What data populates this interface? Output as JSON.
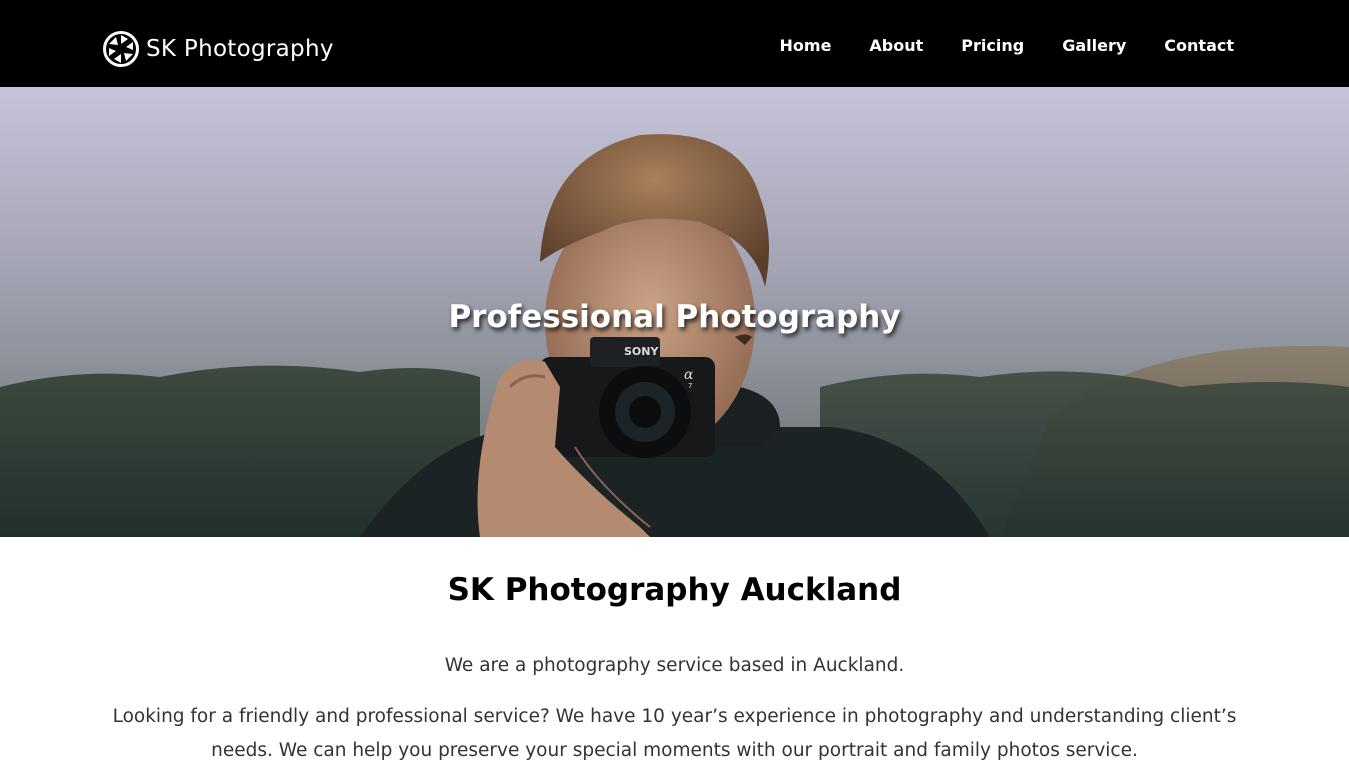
{
  "header": {
    "logo_text": "SK Photography",
    "logo_icon": "camera-aperture-icon"
  },
  "nav": {
    "items": [
      {
        "label": "Home"
      },
      {
        "label": "About"
      },
      {
        "label": "Pricing"
      },
      {
        "label": "Gallery"
      },
      {
        "label": "Contact"
      }
    ]
  },
  "hero": {
    "title": "Professional Photography",
    "camera_brand": "SONY",
    "camera_model": "α",
    "camera_model_sub": "7"
  },
  "content": {
    "heading": "SK Photography Auckland",
    "intro": "We are a photography service based in Auckland.",
    "body": "Looking for a friendly and professional service? We have 10 year’s experience in photography and understanding client’s needs. We can help you preserve your special moments with our portrait and family photos service."
  },
  "colors": {
    "header_bg": "#000000",
    "nav_text": "#ffffff",
    "body_text": "#333333",
    "heading_text": "#000000"
  }
}
